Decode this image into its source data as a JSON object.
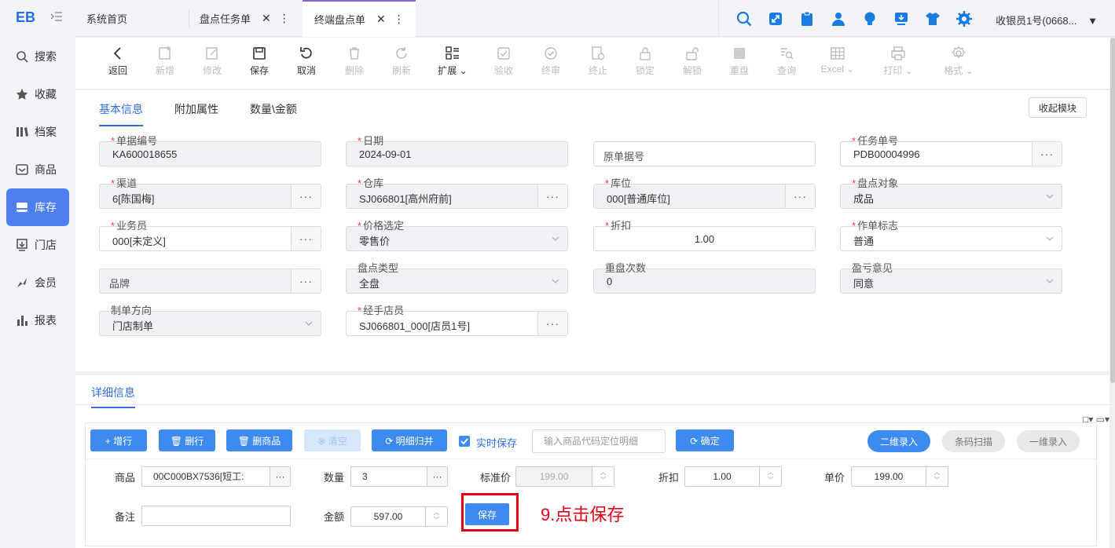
{
  "sidebar": {
    "logo": "EB",
    "items": [
      {
        "label": "搜索",
        "icon": "search-icon"
      },
      {
        "label": "收藏",
        "icon": "star-icon"
      },
      {
        "label": "档案",
        "icon": "archive-icon"
      },
      {
        "label": "商品",
        "icon": "product-icon"
      },
      {
        "label": "库存",
        "icon": "inventory-icon",
        "active": true
      },
      {
        "label": "门店",
        "icon": "store-icon"
      },
      {
        "label": "会员",
        "icon": "member-icon"
      },
      {
        "label": "报表",
        "icon": "report-icon"
      }
    ]
  },
  "tabs": [
    {
      "label": "系统首页"
    },
    {
      "label": "盘点任务单",
      "close": "✕",
      "more": "⋮"
    },
    {
      "label": "终端盘点单",
      "close": "✕",
      "more": "⋮",
      "active": true
    }
  ],
  "user": {
    "name": "收银员1号(0668..."
  },
  "toolbar": {
    "back": "返回",
    "add": "新增",
    "edit": "修改",
    "save": "保存",
    "cancel": "取消",
    "delete": "删除",
    "refresh": "刷新",
    "expand": "扩展",
    "check": "验收",
    "audit": "终审",
    "terminate": "终止",
    "lock": "锁定",
    "unlock": "解锁",
    "recount": "重盘",
    "query": "查询",
    "excel": "Excel",
    "print": "打印",
    "format": "格式"
  },
  "form": {
    "tabs": [
      "基本信息",
      "附加属性",
      "数量\\金额"
    ],
    "collapse_label": "收起模块",
    "doc_no": {
      "label": "单据编号",
      "value": "KA600018655"
    },
    "date": {
      "label": "日期",
      "value": "2024-09-01"
    },
    "orig_no": {
      "placeholder": "原单据号"
    },
    "task_no": {
      "label": "任务单号",
      "value": "PDB00004996"
    },
    "channel": {
      "label": "渠道",
      "value": "6[陈国梅]"
    },
    "warehouse": {
      "label": "仓库",
      "value": "SJ066801[高州府前]"
    },
    "location": {
      "label": "库位",
      "value": "000[普通库位]"
    },
    "count_object": {
      "label": "盘点对象",
      "value": "成品"
    },
    "salesman": {
      "label": "业务员",
      "value": "000[未定义]"
    },
    "price_select": {
      "label": "价格选定",
      "value": "零售价"
    },
    "discount": {
      "label": "折扣",
      "value": "1.00"
    },
    "work_flag": {
      "label": "作单标志",
      "value": "普通"
    },
    "brand": {
      "placeholder": "品牌"
    },
    "count_type": {
      "label": "盘点类型",
      "value": "全盘"
    },
    "recount_times": {
      "label": "重盘次数",
      "value": "0"
    },
    "pl_opinion": {
      "label": "盈亏意见",
      "value": "同意"
    },
    "direction": {
      "label": "制单方向",
      "value": "门店制单"
    },
    "clerk": {
      "label": "经手店员",
      "value": "SJ066801_000[店员1号]"
    },
    "dots": "···",
    "req": "*"
  },
  "detail": {
    "tab": "详细信息",
    "mini_icons": "□▾ ▭▾",
    "buttons": {
      "add_row": "+ 增行",
      "del_row": "🗑 删行",
      "del_product": "🗑 删商品",
      "clear": "⊗ 清空",
      "merge": "⟳ 明细归并",
      "confirm": "⟳ 确定",
      "qr_entry": "二维录入",
      "barcode": "条码扫描",
      "one_entry": "一维录入"
    },
    "realtime_save": "实时保存",
    "search_placeholder": "输入商品代码定位明细",
    "product": {
      "label": "商品",
      "value": "00C000BX7536[短工:"
    },
    "qty": {
      "label": "数量",
      "value": "3"
    },
    "std_price": {
      "label": "标准价",
      "value": "199.00"
    },
    "discount": {
      "label": "折扣",
      "value": "1.00"
    },
    "unit_price": {
      "label": "单价",
      "value": "199.00"
    },
    "remark": {
      "label": "备注",
      "value": ""
    },
    "amount": {
      "label": "金额",
      "value": "597.00"
    },
    "save": "保存",
    "annotation": "9.点击保存"
  }
}
